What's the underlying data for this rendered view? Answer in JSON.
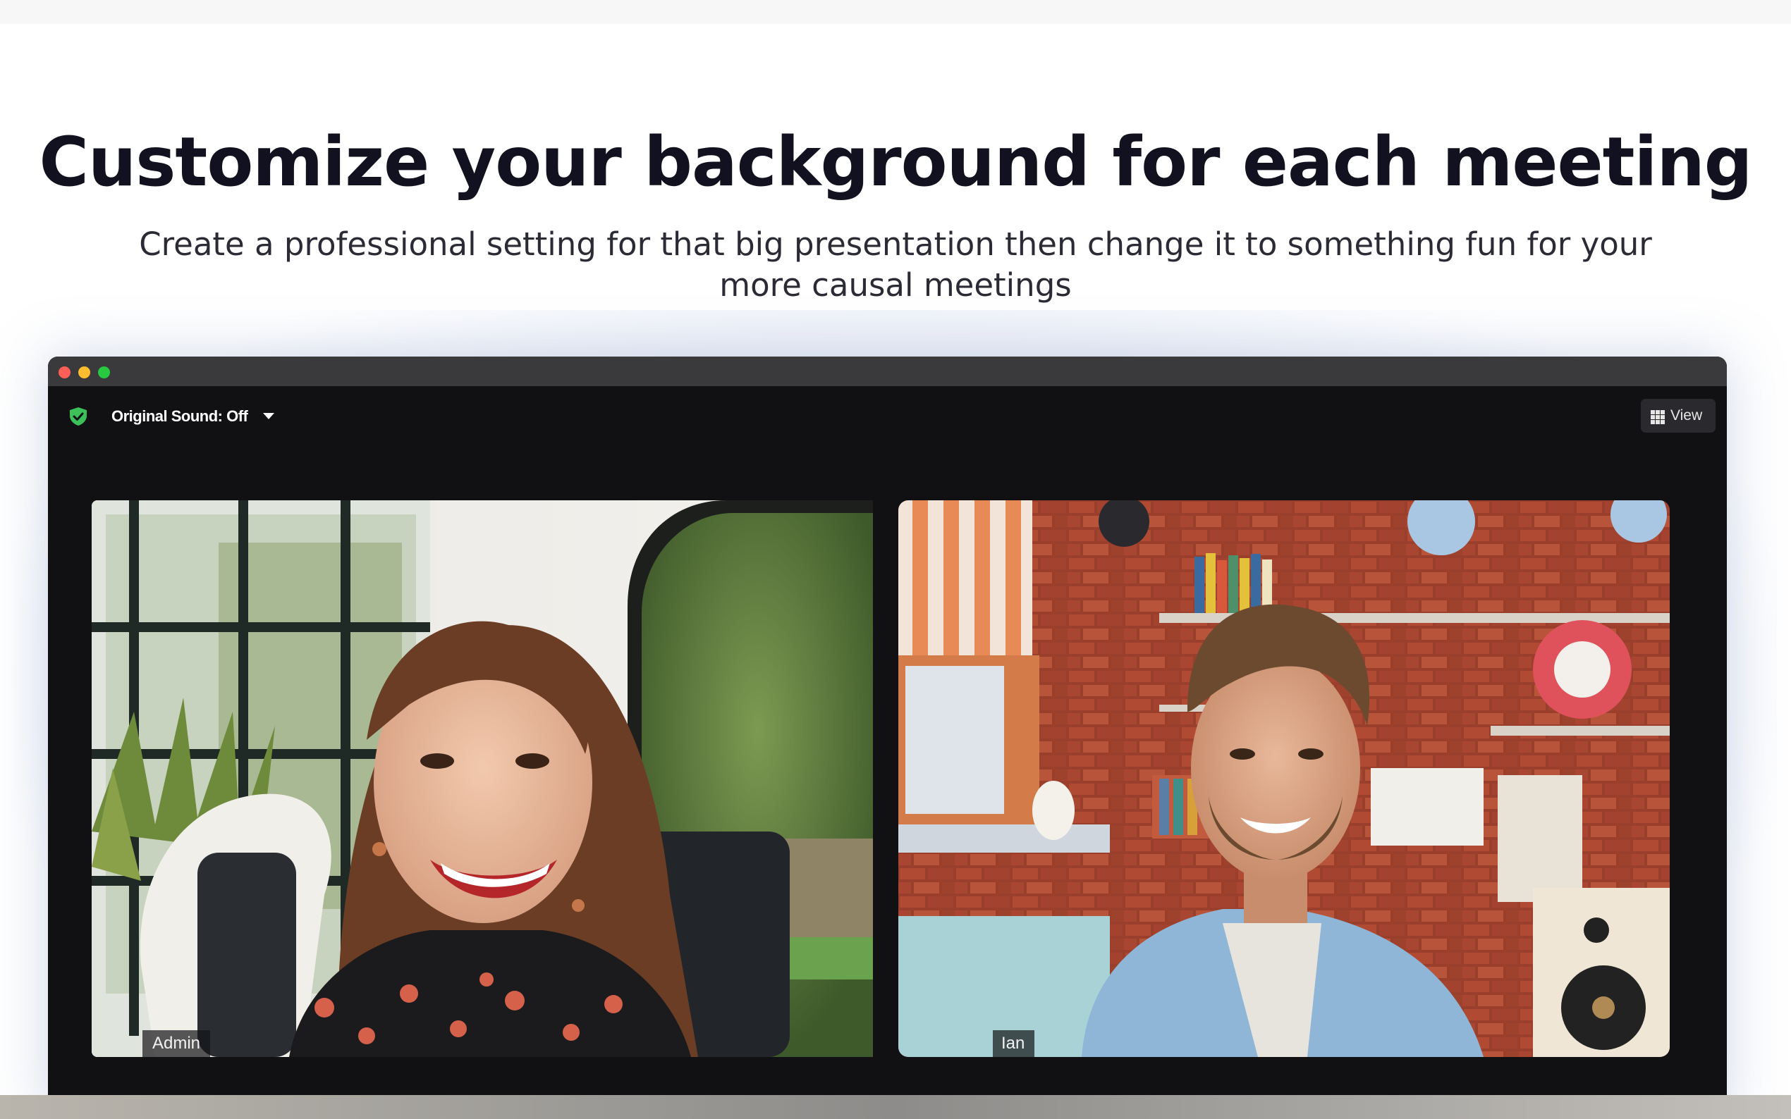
{
  "hero": {
    "title": "Customize your background for each meeting",
    "subtitle": "Create a professional setting for that big presentation then change it to something fun for your more causal meetings"
  },
  "meeting_window": {
    "toolbar": {
      "sound_label": "Original Sound: Off",
      "view_label": "View",
      "icons": [
        "shield-check-icon",
        "caret-down-icon",
        "grid-icon"
      ]
    },
    "participants": [
      {
        "name": "Admin"
      },
      {
        "name": "Ian"
      }
    ]
  },
  "colors": {
    "headline": "#11111f",
    "window_bg": "#111113",
    "titlebar": "#3a3a3c",
    "shield": "#3cc15a",
    "brick": "#9a3f2c"
  }
}
